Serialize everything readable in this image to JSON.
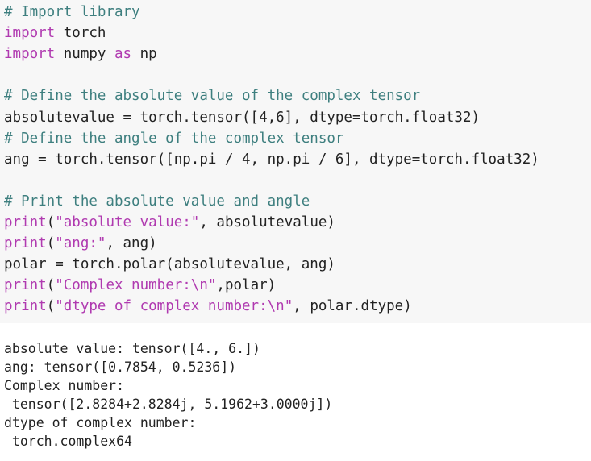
{
  "code_cell": {
    "lines": [
      {
        "text": "# Import library",
        "kind": "comment"
      },
      {
        "text": "import torch",
        "kind": "code"
      },
      {
        "text": "import numpy as np",
        "kind": "code"
      },
      {
        "text": "",
        "kind": "blank"
      },
      {
        "text": "# Define the absolute value of the complex tensor",
        "kind": "comment"
      },
      {
        "text": "absolutevalue = torch.tensor([4,6], dtype=torch.float32)",
        "kind": "code"
      },
      {
        "text": "# Define the angle of the complex tensor",
        "kind": "comment"
      },
      {
        "text": "ang = torch.tensor([np.pi / 4, np.pi / 6], dtype=torch.float32)",
        "kind": "code"
      },
      {
        "text": "",
        "kind": "blank"
      },
      {
        "text": "# Print the absolute value and angle",
        "kind": "comment"
      },
      {
        "text": "print(\"absolute value:\", absolutevalue)",
        "kind": "code"
      },
      {
        "text": "print(\"ang:\", ang)",
        "kind": "code"
      },
      {
        "text": "polar = torch.polar(absolutevalue, ang)",
        "kind": "code"
      },
      {
        "text": "print(\"Complex number:\\n\",polar)",
        "kind": "code"
      },
      {
        "text": "print(\"dtype of complex number:\\n\", polar.dtype)",
        "kind": "code"
      }
    ]
  },
  "output": {
    "lines": [
      "absolute value: tensor([4., 6.])",
      "ang: tensor([0.7854, 0.5236])",
      "Complex number:",
      " tensor([2.8284+2.8284j, 5.1962+3.0000j])",
      "dtype of complex number:",
      " torch.complex64"
    ]
  },
  "colors": {
    "code_background": "#f7f7f7",
    "comment": "#3e7f7f",
    "keyword": "#b03ab0",
    "string": "#b03ab0",
    "text": "#222222"
  }
}
